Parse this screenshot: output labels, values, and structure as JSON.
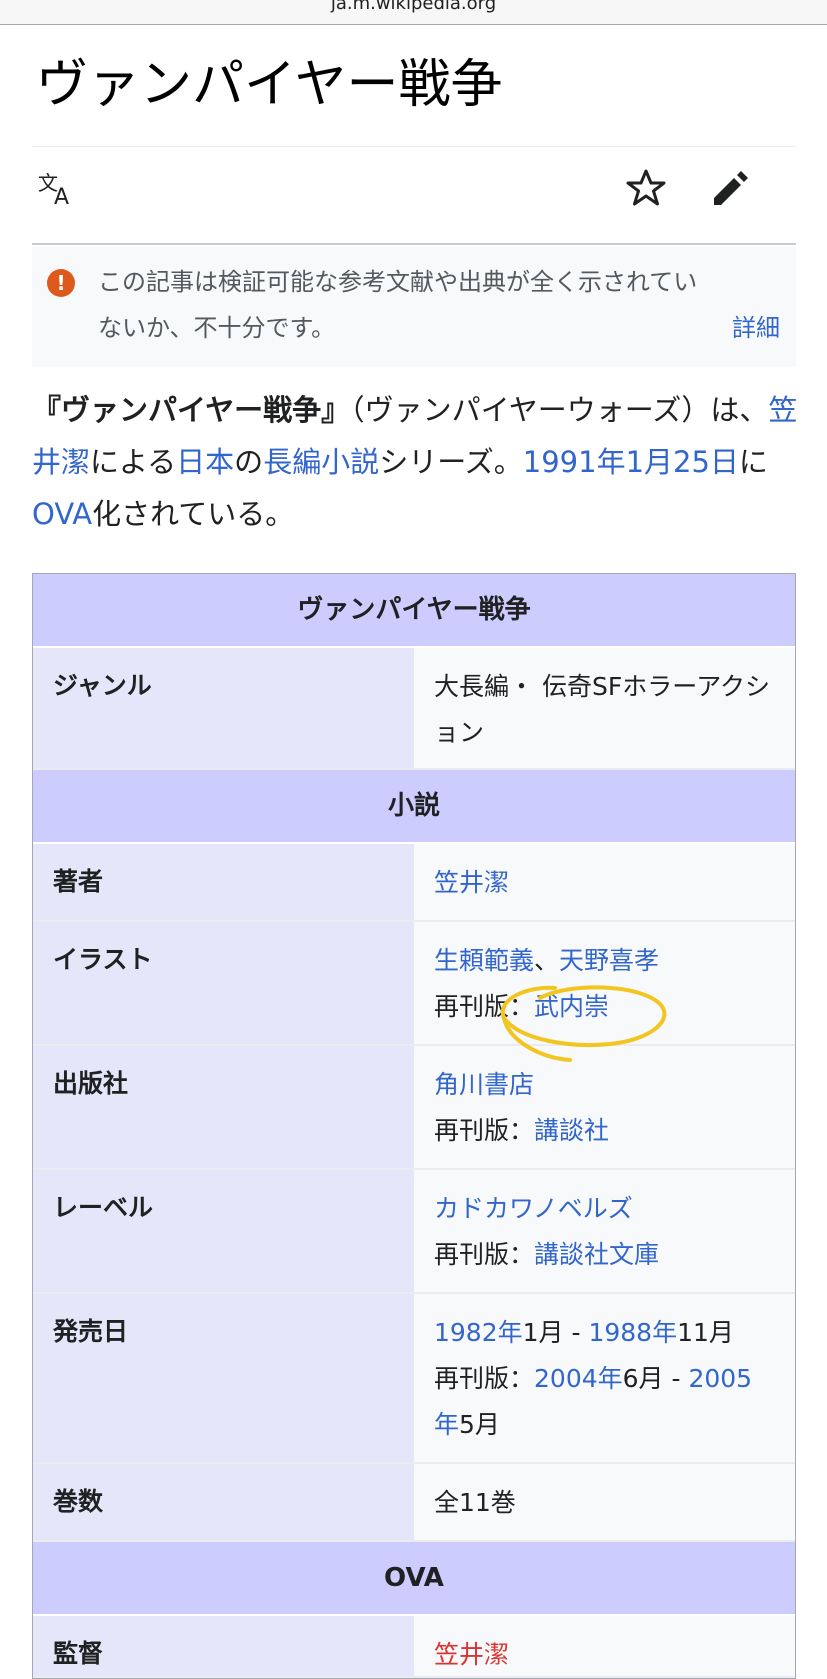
{
  "browser": {
    "url_fragment": "ja.m.wikipedia.org"
  },
  "page": {
    "title": "ヴァンパイヤー戦争"
  },
  "toolbar": {
    "language_icon": "translate-icon",
    "watch_icon": "star-icon",
    "edit_icon": "pencil-icon"
  },
  "notice": {
    "icon": "exclamation-icon",
    "text": "この記事は検証可能な参考文献や出典が全く示されていないか、不十分です。",
    "link": "詳細"
  },
  "lead": {
    "bold_title": "『ヴァンパイヤー戦争』",
    "reading": "（ヴァンパイヤーウォーズ）",
    "t1": "は、",
    "author_link": "笠井潔",
    "t2": "による",
    "country_link": "日本",
    "t3": "の",
    "genre_link": "長編小説",
    "t4": "シリーズ。",
    "date_link": "1991年1月25日",
    "t5": "に",
    "ova_link": "OVA",
    "t6": "化されている。"
  },
  "infobox": {
    "title": "ヴァンパイヤー戦争",
    "genre_label": "ジャンル",
    "genre_value": "大長編・ 伝奇SFホラーアクション",
    "novel_header": "小説",
    "author_label": "著者",
    "author_value": "笠井潔",
    "illust_label": "イラスト",
    "illust_value1": "生頼範義",
    "illust_sep": "、",
    "illust_value2": "天野喜孝",
    "reprint_prefix": "再刊版：",
    "illust_reprint": "武内崇",
    "publisher_label": "出版社",
    "publisher_value": "角川書店",
    "publisher_reprint": "講談社",
    "label_label": "レーベル",
    "label_value": "カドカワノベルズ",
    "label_reprint": "講談社文庫",
    "release_label": "発売日",
    "release_y1": "1982年",
    "release_m1": "1月",
    "release_dash": " - ",
    "release_y2": "1988年",
    "release_m2": "11月",
    "release_ry1": "2004年",
    "release_rm1": "6月",
    "release_ry2": "2005年",
    "release_rm2": "5月",
    "volumes_label": "巻数",
    "volumes_value": "全11巻",
    "ova_header": "OVA",
    "director_label": "監督",
    "director_value": "笠井潔",
    "highlight_color": "#f5c518"
  }
}
